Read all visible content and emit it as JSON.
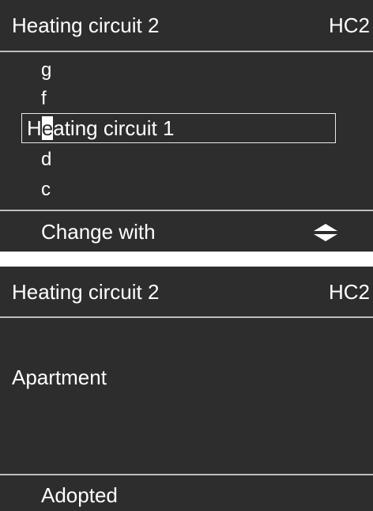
{
  "screen1": {
    "header": {
      "title": "Heating circuit 2",
      "code": "HC2"
    },
    "list": [
      "g",
      "f",
      "d",
      "c"
    ],
    "edit_field": {
      "before_cursor": "H",
      "cursor_char": "e",
      "after_cursor": "ating circuit 1"
    },
    "footer": {
      "label": "Change with",
      "icon": "up-down-arrows-icon"
    }
  },
  "screen2": {
    "header": {
      "title": "Heating circuit 2",
      "code": "HC2"
    },
    "value": "Apartment",
    "footer": {
      "label": "Adopted"
    }
  }
}
